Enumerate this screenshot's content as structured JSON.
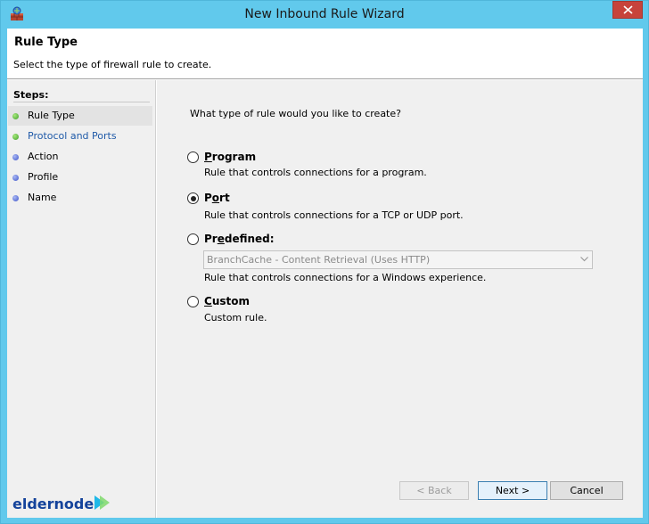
{
  "window": {
    "title": "New Inbound Rule Wizard"
  },
  "header": {
    "title": "Rule Type",
    "description": "Select the type of firewall rule to create."
  },
  "steps": {
    "title": "Steps:",
    "items": [
      {
        "label": "Rule Type",
        "state": "current",
        "bullet": "green"
      },
      {
        "label": "Protocol and Ports",
        "state": "link",
        "bullet": "green"
      },
      {
        "label": "Action",
        "state": "pending",
        "bullet": "blue"
      },
      {
        "label": "Profile",
        "state": "pending",
        "bullet": "blue"
      },
      {
        "label": "Name",
        "state": "pending",
        "bullet": "blue"
      }
    ]
  },
  "main": {
    "question": "What type of rule would you like to create?",
    "options": [
      {
        "label": "Program",
        "access_key": "P",
        "description": "Rule that controls connections for a program.",
        "selected": false
      },
      {
        "label": "Port",
        "access_key": "o",
        "description": "Rule that controls connections for a TCP or UDP port.",
        "selected": true
      },
      {
        "label": "Predefined:",
        "access_key": "e",
        "description": "Rule that controls connections for a Windows experience.",
        "selected": false
      },
      {
        "label": "Custom",
        "access_key": "C",
        "description": "Custom rule.",
        "selected": false
      }
    ],
    "predefined_dropdown": {
      "selected": "BranchCache - Content Retrieval (Uses HTTP)",
      "enabled": false
    }
  },
  "buttons": {
    "back": "< Back",
    "next": "Next >",
    "cancel": "Cancel"
  },
  "logo": {
    "text": "eldernode"
  },
  "colors": {
    "titlebar": "#61c9ec",
    "close": "#c7433b",
    "link": "#1f5aa8",
    "logo": "#14439b",
    "logo_accent": "#1fb8e8"
  }
}
